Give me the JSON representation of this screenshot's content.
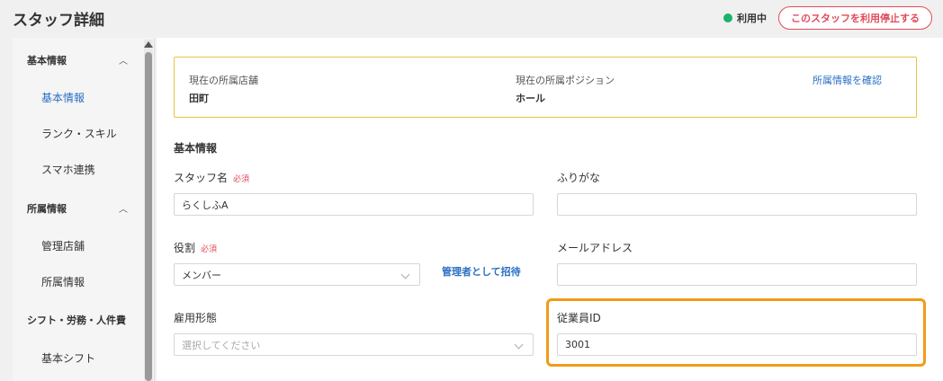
{
  "header": {
    "title": "スタッフ詳細",
    "status_label": "利用中",
    "status_color": "#1bb36a",
    "suspend_button": "このスタッフを利用停止する"
  },
  "sidebar": {
    "sections": [
      {
        "label": "基本情報",
        "items": [
          "基本情報",
          "ランク・スキル",
          "スマホ連携"
        ]
      },
      {
        "label": "所属情報",
        "items": [
          "管理店舗",
          "所属情報"
        ]
      },
      {
        "label": "シフト・労務・人件費",
        "items": [
          "基本シフト"
        ]
      }
    ],
    "active_item": "基本情報"
  },
  "affiliation": {
    "store_label": "現在の所属店舗",
    "store_value": "田町",
    "position_label": "現在の所属ポジション",
    "position_value": "ホール",
    "confirm_link": "所属情報を確認"
  },
  "form": {
    "section_title": "基本情報",
    "required_badge": "必須",
    "staff_name": {
      "label": "スタッフ名",
      "value": "らくしふA"
    },
    "furigana": {
      "label": "ふりがな",
      "value": ""
    },
    "role": {
      "label": "役割",
      "value": "メンバー"
    },
    "invite_admin_link": "管理者として招待",
    "email": {
      "label": "メールアドレス",
      "value": ""
    },
    "employment_type": {
      "label": "雇用形態",
      "placeholder": "選択してください"
    },
    "employee_id": {
      "label": "従業員ID",
      "value": "3001"
    }
  },
  "colors": {
    "accent_link": "#2a6fc4",
    "danger": "#e14b5a",
    "highlight": "#f29a1a",
    "affiliation_border": "#e8c43e"
  }
}
